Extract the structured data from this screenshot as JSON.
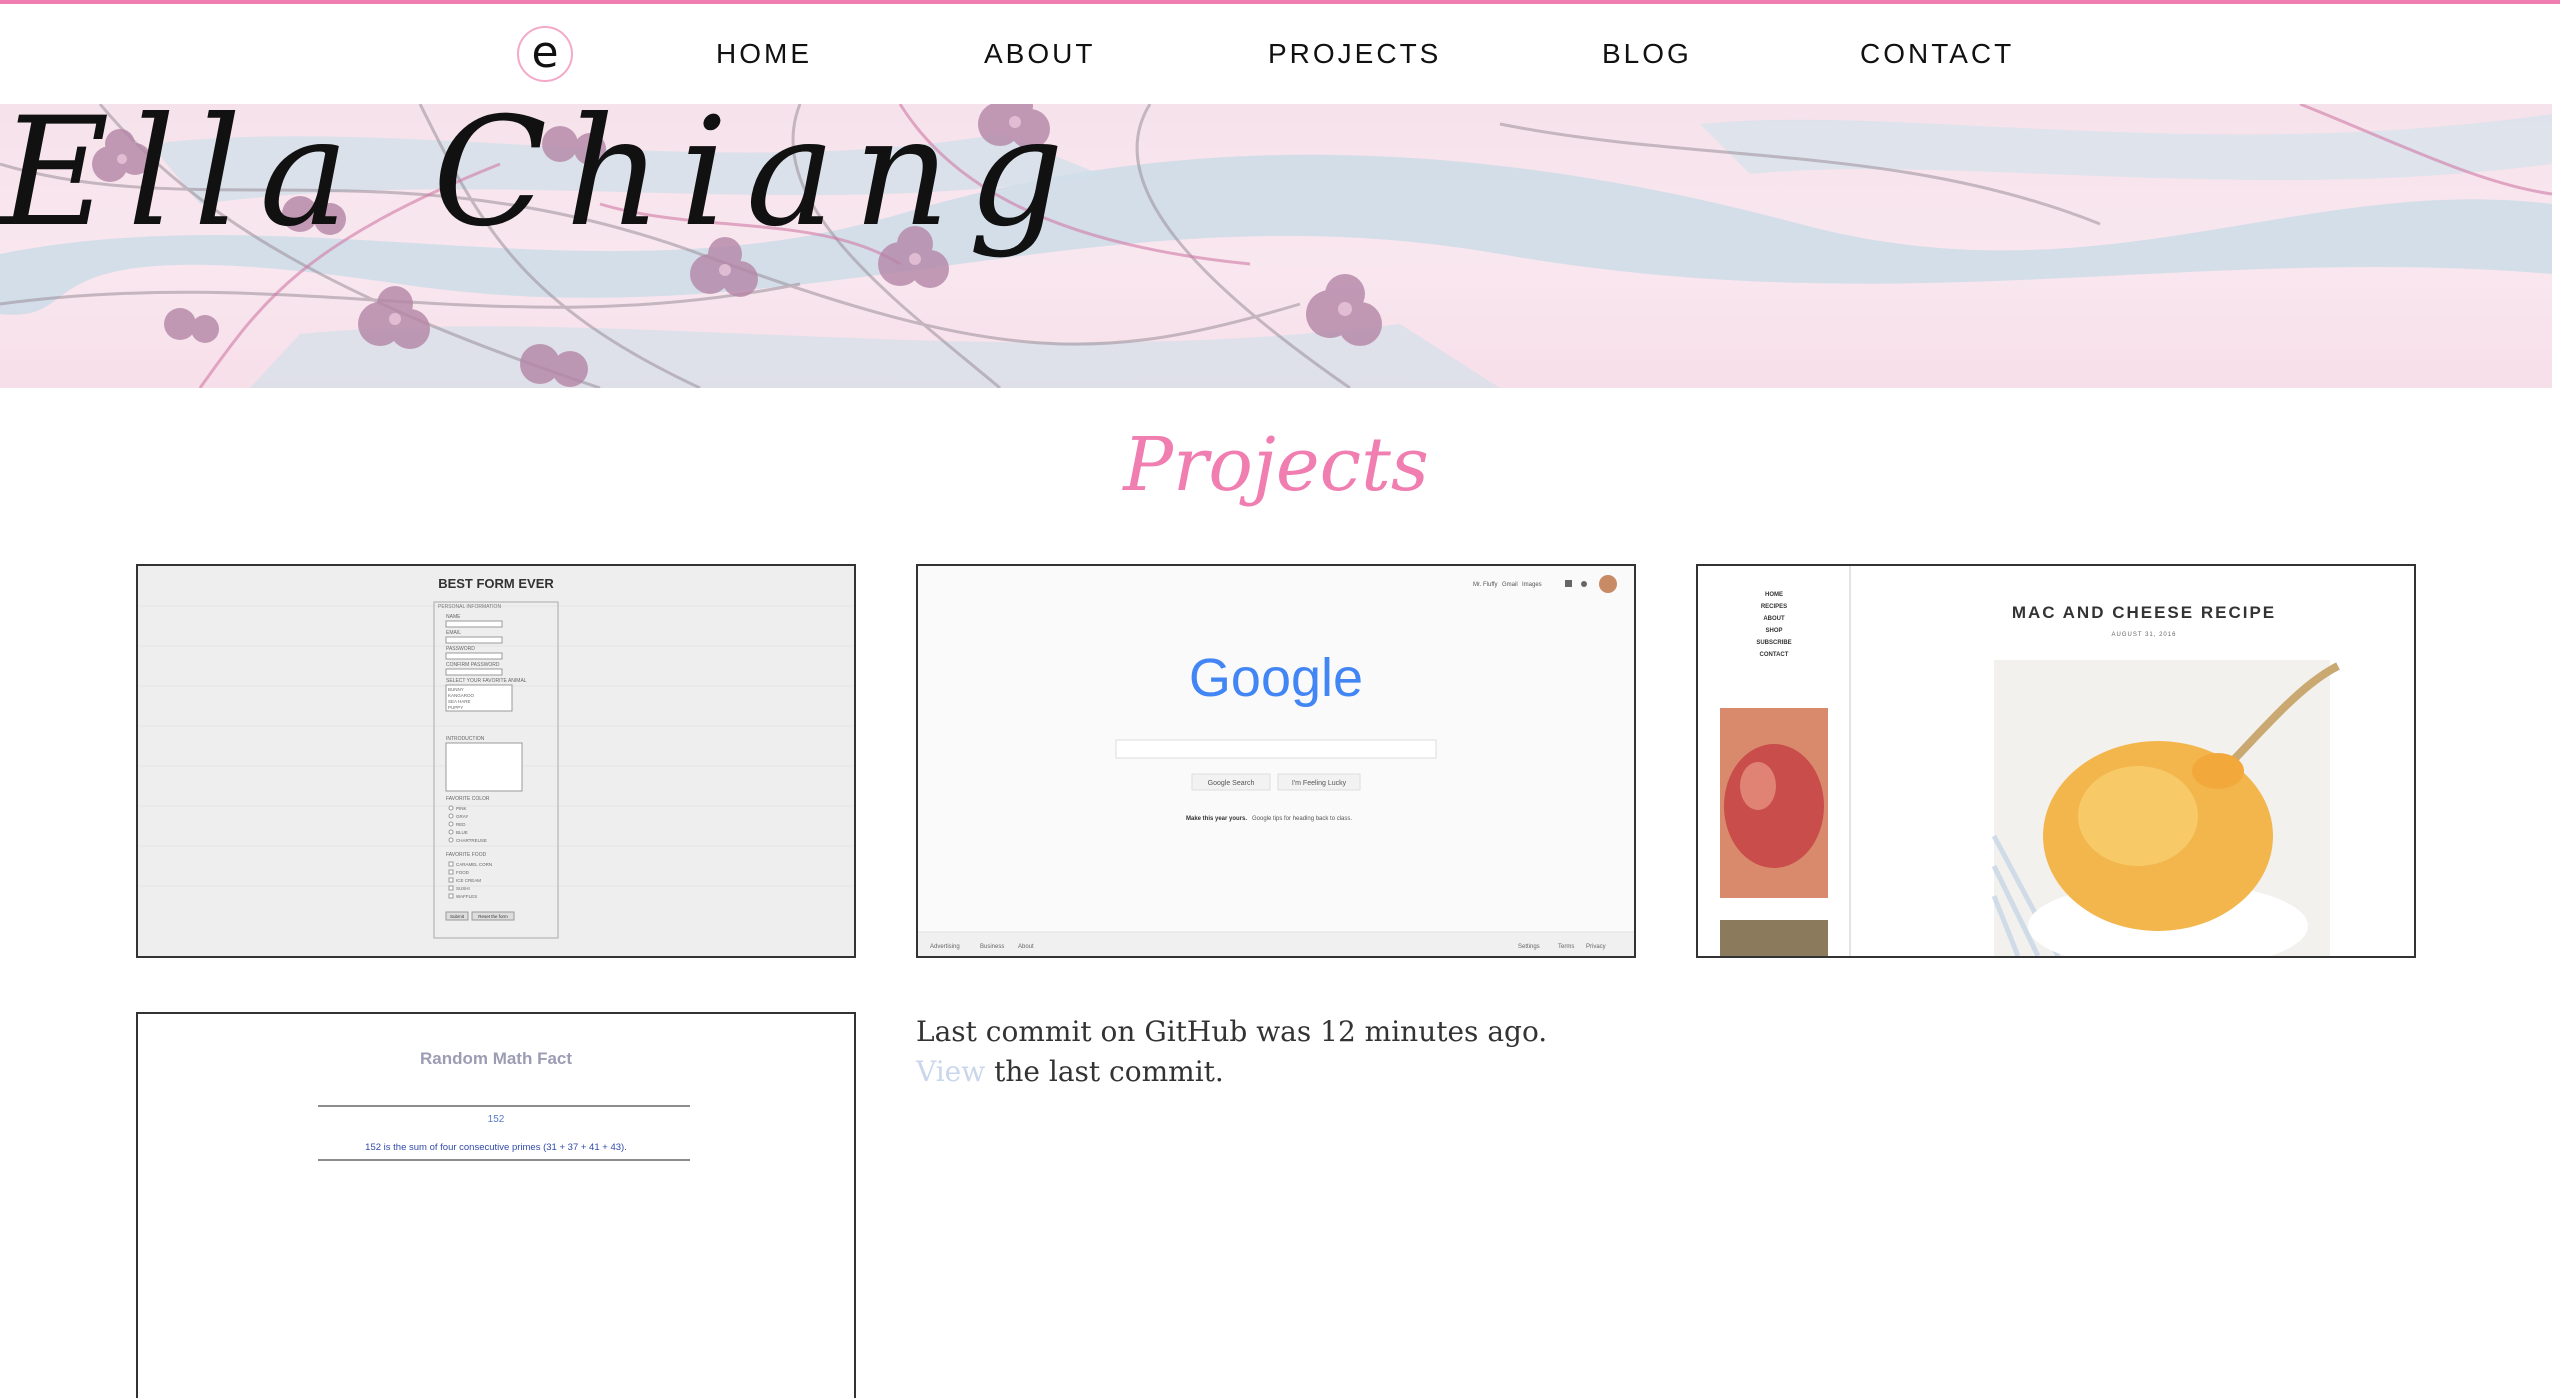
{
  "nav": {
    "logo_letter": "e",
    "items": [
      {
        "label": "HOME"
      },
      {
        "label": "ABOUT"
      },
      {
        "label": "PROJECTS"
      },
      {
        "label": "BLOG"
      },
      {
        "label": "CONTACT"
      }
    ]
  },
  "banner": {
    "name": "Ella Chiang"
  },
  "page": {
    "title": "Projects"
  },
  "projects": [
    {
      "form_title": "BEST FORM EVER",
      "legend": "PERSONAL INFORMATION",
      "fields": [
        "NAME",
        "EMAIL",
        "PASSWORD",
        "CONFIRM PASSWORD"
      ],
      "animal_label": "SELECT YOUR FAVORITE ANIMAL",
      "animals": [
        "BUNNY",
        "KANGAROO",
        "SEA HARE",
        "PUPPY"
      ],
      "intro_label": "INTRODUCTION",
      "color_label": "FAVORITE COLOR",
      "colors": [
        "PINK",
        "GRAY",
        "RED",
        "BLUE",
        "CHARTREUSE"
      ],
      "food_label": "FAVORITE FOOD",
      "foods": [
        "CARAMEL CORN",
        "FOOD",
        "ICE CREAM",
        "SUSHI",
        "WAFFLES"
      ],
      "buttons": [
        "Submit",
        "Reset the form"
      ]
    },
    {
      "top_links": [
        "Mr. Fluffy",
        "Gmail",
        "Images"
      ],
      "logo": "Google",
      "buttons": [
        "Google Search",
        "I'm Feeling Lucky"
      ],
      "promo_bold": "Make this year yours.",
      "promo_text": "Google tips for heading back to class.",
      "footer_left": [
        "Advertising",
        "Business",
        "About"
      ],
      "footer_right": [
        "Settings",
        "Terms",
        "Privacy"
      ]
    },
    {
      "side_nav": [
        "HOME",
        "RECIPES",
        "ABOUT",
        "SHOP",
        "SUBSCRIBE",
        "CONTACT"
      ],
      "title": "MAC AND CHEESE RECIPE",
      "date": "AUGUST 31, 2016"
    },
    {
      "title": "Random Math Fact",
      "number": "152",
      "fact": "152 is the sum of four consecutive primes (31 + 37 + 41 + 43)."
    }
  ],
  "commit": {
    "line1": "Last commit on GitHub was 12 minutes ago.",
    "link": "View",
    "line2_rest": " the last commit."
  }
}
